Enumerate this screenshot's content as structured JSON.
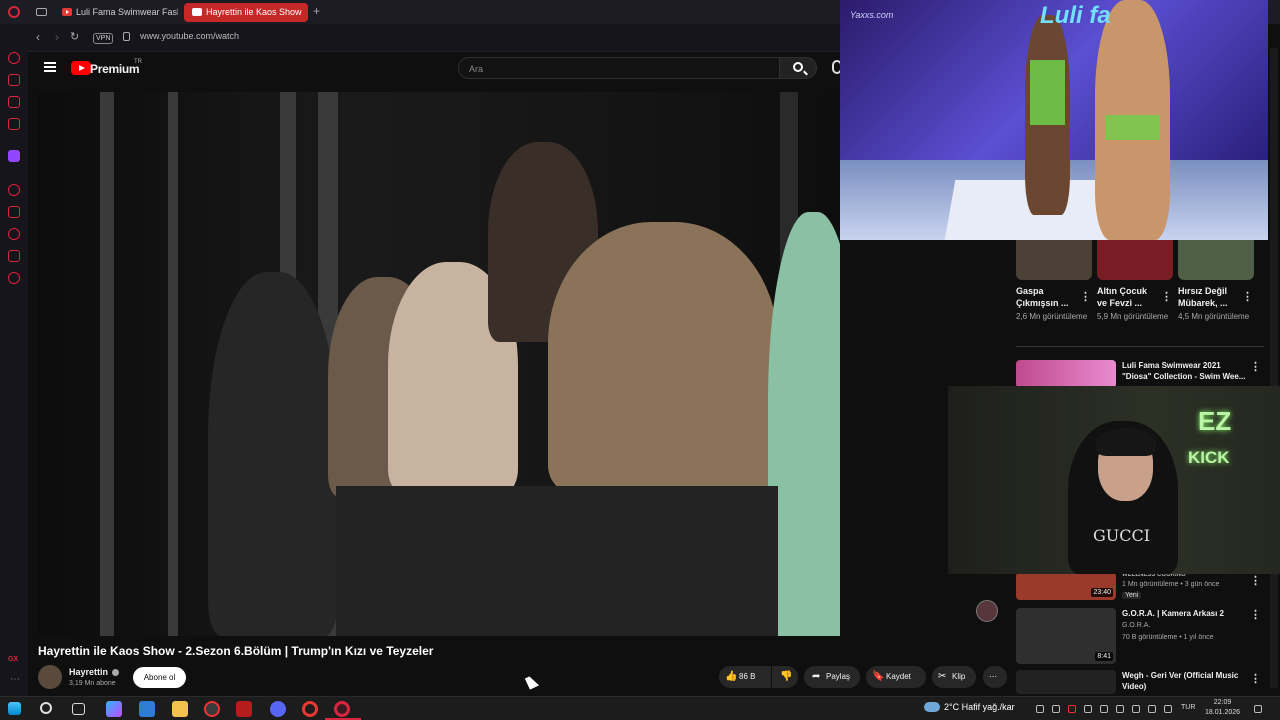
{
  "browser": {
    "tabs": [
      {
        "label": "Luli Fama Swimwear Fash",
        "active": false
      },
      {
        "label": "Hayrettin ile Kaos Show",
        "active": true
      }
    ],
    "new_tab": "+",
    "vpn": "VPN",
    "url": "www.youtube.com/watch"
  },
  "youtube": {
    "logo": "Premium",
    "logo_country": "TR",
    "search_placeholder": "Ara"
  },
  "video": {
    "title": "Hayrettin ile Kaos Show - 2.Sezon 6.Bölüm | Trump'ın Kızı ve Teyzeler",
    "channel": "Hayrettin",
    "subscribers": "3,19 Mn abone",
    "subscribe_label": "Abone ol",
    "likes": "86 B",
    "share_label": "Paylaş",
    "save_label": "Kaydet",
    "clip_label": "Klip",
    "more": "⋯"
  },
  "pip": {
    "watermark": "Yaxxs.com",
    "logo": "Luli fa"
  },
  "shorts": [
    {
      "title": "Gaspa Çıkmışsın ...",
      "views": "2,6 Mn görüntüleme"
    },
    {
      "title": "Altın Çocuk ve Fevzi ...",
      "views": "5,9 Mn görüntüleme"
    },
    {
      "title": "Hırsız Değil Mübarek, ...",
      "views": "4,5 Mn görüntüleme"
    }
  ],
  "recommendations": [
    {
      "title": "Luli Fama Swimwear 2021 \"Diosa\" Collection - Swim Wee...",
      "channel": "",
      "meta": "",
      "duration": ""
    },
    {
      "title": "WELLNESS COOKING",
      "channel": "",
      "meta": "1 Mn görüntüleme • 3 gün önce",
      "badge": "Yeni",
      "duration": "23:40"
    },
    {
      "title": "G.O.R.A. | Kamera Arkası 2",
      "channel": "G.O.R.A.",
      "meta": "70 B görüntüleme • 1 yıl önce",
      "duration": "8:41"
    },
    {
      "title": "Wegh - Geri Ver (Official Music Video)",
      "channel": "",
      "meta": "",
      "duration": ""
    }
  ],
  "webcam": {
    "sign1": "EZ",
    "sign2": "KICK",
    "shirt": "GUCCI"
  },
  "taskbar": {
    "weather": "2°C  Hafif yağ./kar",
    "lang": "TUR",
    "time": "22:09",
    "date": "18.01.2026"
  },
  "colors": {
    "opera_red": "#d7263d",
    "yt_red": "#ff0000",
    "bg": "#0f0f0f"
  }
}
